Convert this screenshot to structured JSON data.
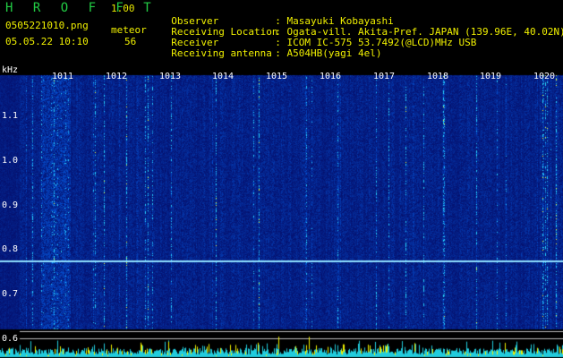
{
  "header": {
    "app_title": "H R O F F T",
    "version": "1.00",
    "filename": "0505221010.png",
    "datetime": "05.05.22 10:10",
    "mode_label": "meteor",
    "meteor_count": "56"
  },
  "info": [
    {
      "label": "Observer",
      "value": ": Masayuki Kobayashi"
    },
    {
      "label": "Receiving Location",
      "value": ": Ogata-vill. Akita-Pref. JAPAN (139.96E, 40.02N)"
    },
    {
      "label": "Receiver",
      "value": ": ICOM IC-575 53.7492(@LCD)MHz USB"
    },
    {
      "label": "Receiving antenna",
      "value": ": A504HB(yagi 4el)"
    }
  ],
  "axes": {
    "y_unit": "kHz",
    "y_ticks": [
      "1.1",
      "1.0",
      "0.9",
      "0.8",
      "0.7",
      "0.6"
    ],
    "x_ticks": [
      "1011",
      "1012",
      "1013",
      "1014",
      "1015",
      "1016",
      "1017",
      "1018",
      "1019",
      "1020"
    ]
  },
  "colors": {
    "background": "#000000",
    "waterfall_base": "#081a8c",
    "highlight": "#f0f000",
    "trace": "#22ccdd"
  }
}
